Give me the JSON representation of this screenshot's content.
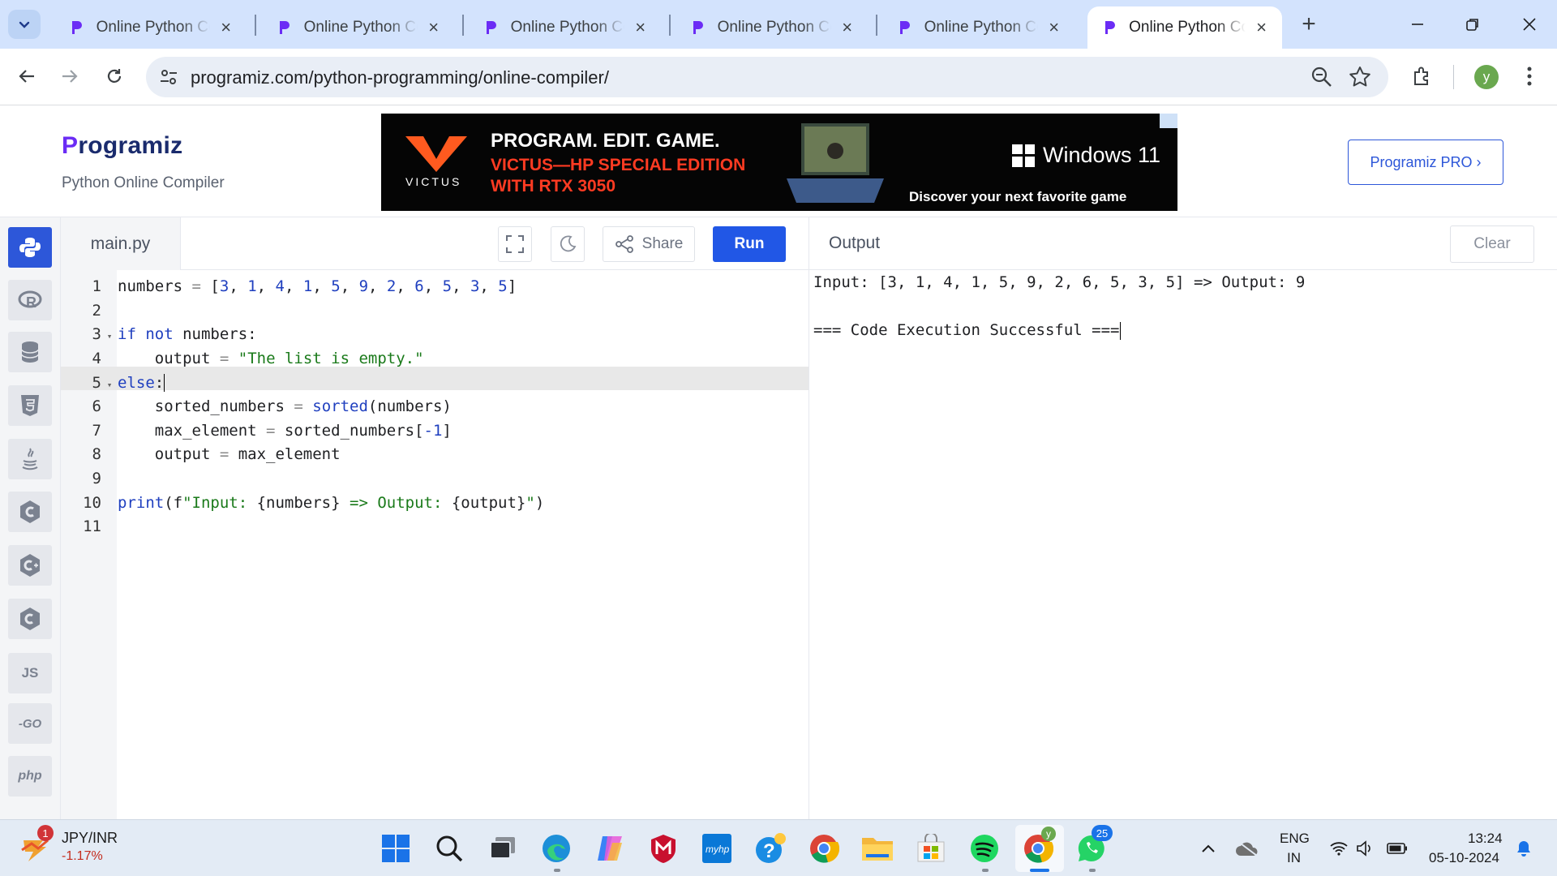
{
  "browser": {
    "tabs": [
      {
        "title": "Online Python Compiler (Interpreter)",
        "active": false
      },
      {
        "title": "Online Python Compiler (Interpreter)",
        "active": false
      },
      {
        "title": "Online Python Compiler (Interpreter)",
        "active": false
      },
      {
        "title": "Online Python Compiler (Interpreter)",
        "active": false
      },
      {
        "title": "Online Python Compiler (Interpreter)",
        "active": false
      },
      {
        "title": "Online Python Compiler (Interpreter)",
        "active": true
      }
    ],
    "url": "programiz.com/python-programming/online-compiler/",
    "profile_initial": "y",
    "colors": {
      "tab_strip": "#d3e3fd",
      "omnibox": "#e9eef6"
    }
  },
  "site": {
    "logo_initial": "P",
    "logo_rest": "rogramiz",
    "subtitle": "Python Online Compiler",
    "pro_button": "Programiz PRO ›",
    "brand_color": "#2d57d9"
  },
  "ad": {
    "brand": "VICTUS",
    "headline": "PROGRAM. EDIT. GAME.",
    "line2": "VICTUS—HP SPECIAL EDITION",
    "line3": "WITH RTX 3050",
    "windows": "Windows 11",
    "tagline": "Discover your next favorite game"
  },
  "languages": [
    "python",
    "r",
    "sql",
    "html5",
    "java",
    "c",
    "cpp",
    "csharp",
    "js",
    "go",
    "php"
  ],
  "languages_text": {
    "js": "JS",
    "go": "GO",
    "php": "php"
  },
  "editor": {
    "file_name": "main.py",
    "share_label": "Share",
    "run_label": "Run",
    "highlighted_line": 5,
    "lines": [
      {
        "n": "1",
        "fold": "",
        "tokens": [
          [
            "id",
            "numbers "
          ],
          [
            "op",
            "="
          ],
          [
            "id",
            " ["
          ],
          [
            "num",
            "3"
          ],
          [
            "id",
            ", "
          ],
          [
            "num",
            "1"
          ],
          [
            "id",
            ", "
          ],
          [
            "num",
            "4"
          ],
          [
            "id",
            ", "
          ],
          [
            "num",
            "1"
          ],
          [
            "id",
            ", "
          ],
          [
            "num",
            "5"
          ],
          [
            "id",
            ", "
          ],
          [
            "num",
            "9"
          ],
          [
            "id",
            ", "
          ],
          [
            "num",
            "2"
          ],
          [
            "id",
            ", "
          ],
          [
            "num",
            "6"
          ],
          [
            "id",
            ", "
          ],
          [
            "num",
            "5"
          ],
          [
            "id",
            ", "
          ],
          [
            "num",
            "3"
          ],
          [
            "id",
            ", "
          ],
          [
            "num",
            "5"
          ],
          [
            "id",
            "]"
          ]
        ]
      },
      {
        "n": "2",
        "fold": "",
        "tokens": []
      },
      {
        "n": "3",
        "fold": "▾",
        "tokens": [
          [
            "kw",
            "if"
          ],
          [
            "id",
            " "
          ],
          [
            "kw",
            "not"
          ],
          [
            "id",
            " numbers:"
          ]
        ]
      },
      {
        "n": "4",
        "fold": "",
        "tokens": [
          [
            "id",
            "    output "
          ],
          [
            "op",
            "="
          ],
          [
            "id",
            " "
          ],
          [
            "str",
            "\"The list is empty.\""
          ]
        ]
      },
      {
        "n": "5",
        "fold": "▾",
        "tokens": [
          [
            "kw",
            "else"
          ],
          [
            "id",
            ":"
          ]
        ],
        "caret": true
      },
      {
        "n": "6",
        "fold": "",
        "tokens": [
          [
            "id",
            "    sorted_numbers "
          ],
          [
            "op",
            "="
          ],
          [
            "id",
            " "
          ],
          [
            "fn",
            "sorted"
          ],
          [
            "id",
            "(numbers)"
          ]
        ]
      },
      {
        "n": "7",
        "fold": "",
        "tokens": [
          [
            "id",
            "    max_element "
          ],
          [
            "op",
            "="
          ],
          [
            "id",
            " sorted_numbers["
          ],
          [
            "num",
            "-1"
          ],
          [
            "id",
            "]"
          ]
        ]
      },
      {
        "n": "8",
        "fold": "",
        "tokens": [
          [
            "id",
            "    output "
          ],
          [
            "op",
            "="
          ],
          [
            "id",
            " max_element"
          ]
        ]
      },
      {
        "n": "9",
        "fold": "",
        "tokens": []
      },
      {
        "n": "10",
        "fold": "",
        "tokens": [
          [
            "fn",
            "print"
          ],
          [
            "id",
            "(f"
          ],
          [
            "str",
            "\"Input: "
          ],
          [
            "id",
            "{numbers}"
          ],
          [
            "str",
            " => Output: "
          ],
          [
            "id",
            "{output}"
          ],
          [
            "str",
            "\""
          ],
          [
            "id",
            ")"
          ]
        ]
      },
      {
        "n": "11",
        "fold": "",
        "tokens": []
      }
    ]
  },
  "output": {
    "title": "Output",
    "clear_label": "Clear",
    "lines": [
      "Input: [3, 1, 4, 1, 5, 9, 2, 6, 5, 3, 5] => Output: 9",
      "",
      "=== Code Execution Successful ==="
    ]
  },
  "taskbar": {
    "ticker_name": "JPY/INR",
    "ticker_change": "-1.17%",
    "ticker_badge": "1",
    "whatsapp_badge": "25",
    "chrome_profile_badge": "y",
    "language_top": "ENG",
    "language_bottom": "IN",
    "time": "13:24",
    "date": "05-10-2024"
  }
}
